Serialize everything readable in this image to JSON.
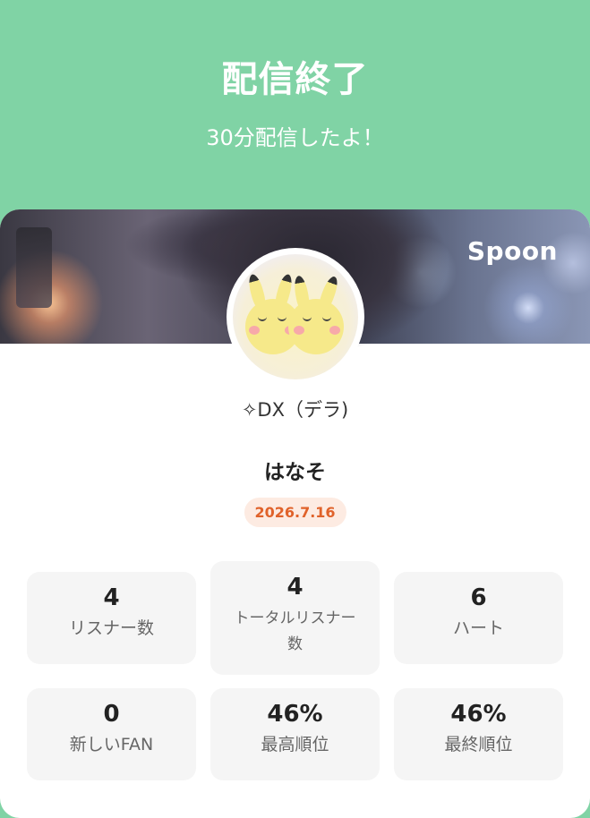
{
  "header": {
    "title": "配信終了",
    "subtitle": "30分配信したよ！"
  },
  "banner": {
    "brand": "Spoon",
    "avatar_icon": "pikachu-avatar"
  },
  "profile": {
    "dj_name": "✧DX（デラ)",
    "broadcast_title": "はなそ",
    "date": "2026.7.16"
  },
  "stats": [
    {
      "value": "4",
      "label": "リスナー数"
    },
    {
      "value": "4",
      "label": "トータルリスナー数"
    },
    {
      "value": "6",
      "label": "ハート"
    },
    {
      "value": "0",
      "label": "新しいFAN"
    },
    {
      "value": "46%",
      "label": "最高順位"
    },
    {
      "value": "46%",
      "label": "最終順位"
    }
  ],
  "colors": {
    "header_bg": "#80d3a5",
    "card_bg": "#ffffff",
    "stat_bg": "#f5f5f5",
    "date_text": "#e0622a",
    "date_bg": "#fdebe2"
  }
}
